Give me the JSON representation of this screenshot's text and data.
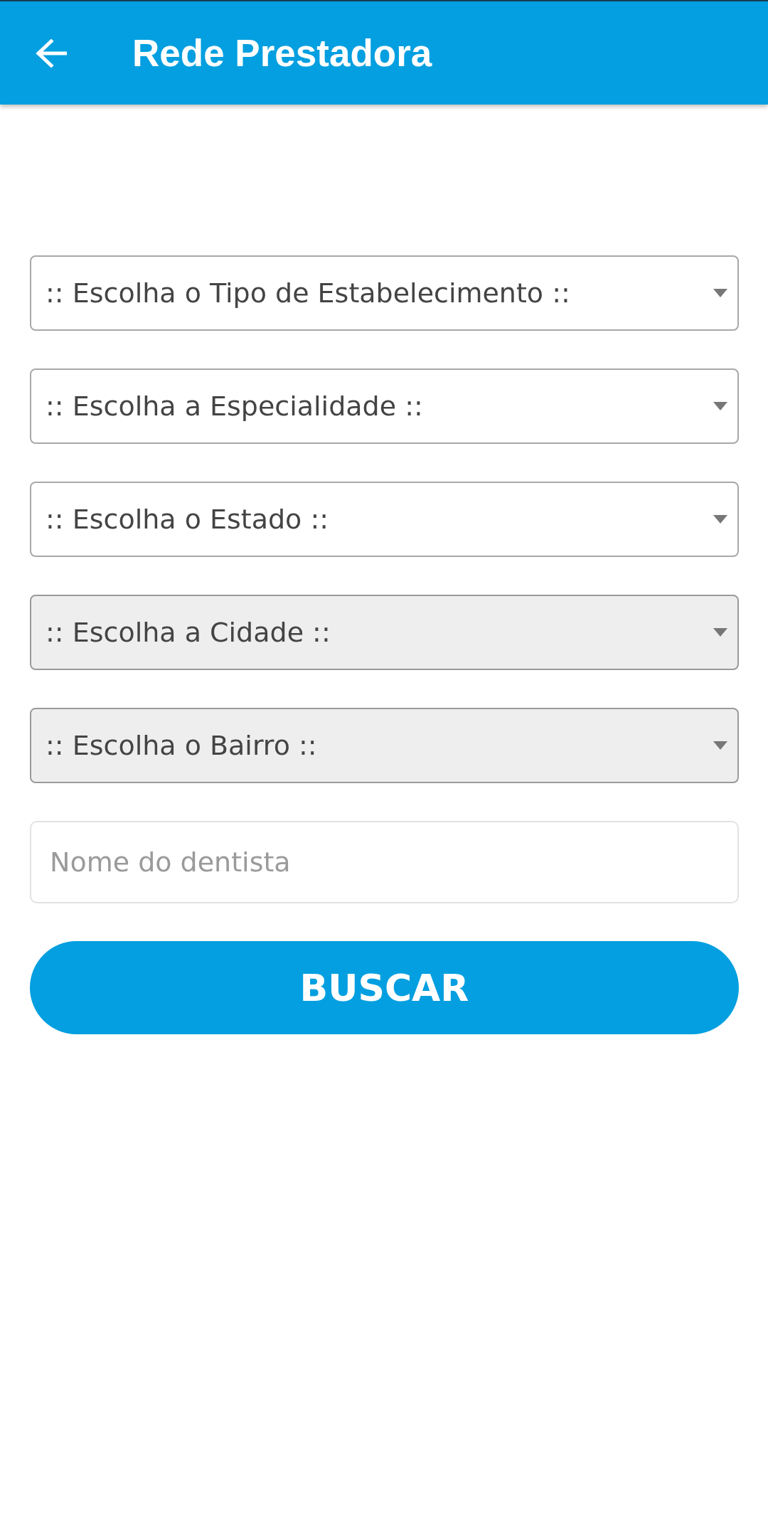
{
  "app_bar": {
    "title": "Rede Prestadora"
  },
  "filters": [
    {
      "value": ":: Escolha o Tipo de Estabelecimento ::",
      "disabled": false
    },
    {
      "value": ":: Escolha a Especialidade ::",
      "disabled": false
    },
    {
      "value": ":: Escolha o Estado ::",
      "disabled": false
    },
    {
      "value": ":: Escolha a Cidade ::",
      "disabled": true
    },
    {
      "value": ":: Escolha o Bairro ::",
      "disabled": true
    }
  ],
  "name_field": {
    "placeholder": "Nome do dentista"
  },
  "search_button": {
    "label": "BUSCAR"
  }
}
